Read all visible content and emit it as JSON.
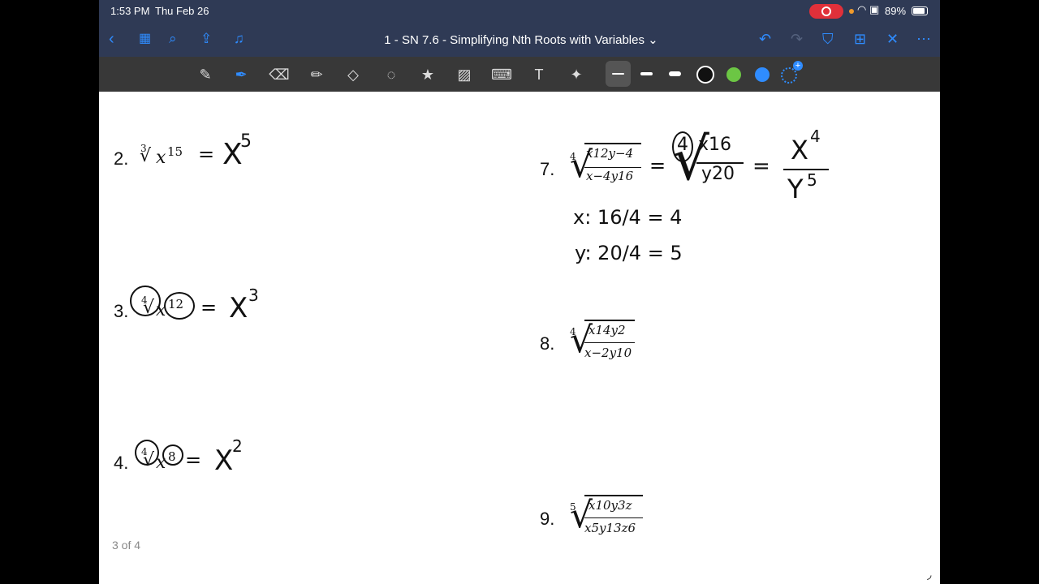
{
  "status": {
    "time": "1:53 PM",
    "date": "Thu Feb 26",
    "battery": "89%"
  },
  "nav": {
    "title": "1 - SN 7.6 - Simplifying Nth Roots with Variables",
    "title_chevron": "⌄"
  },
  "toolbar": {
    "colors": [
      "#111111",
      "#6cc644",
      "#2f8cff"
    ]
  },
  "problems": {
    "p2": {
      "num": "2.",
      "index": "3",
      "radicand": "x",
      "exp": "15",
      "answer": "X",
      "ans_exp": "5"
    },
    "p3": {
      "num": "3.",
      "index": "4",
      "radicand": "x",
      "exp": "12",
      "answer": "X",
      "ans_exp": "3"
    },
    "p4": {
      "num": "4.",
      "index": "4",
      "radicand": "x",
      "exp": "8",
      "answer": "X",
      "ans_exp": "2"
    },
    "p7": {
      "num": "7.",
      "index": "4",
      "num_expr": "x12y−4",
      "den_expr": "x−4y16",
      "step_index": "4",
      "step_num": "x16",
      "step_den": "y20",
      "answer_num": "X",
      "answer_num_exp": "4",
      "answer_den": "Y",
      "answer_den_exp": "5",
      "work_x": "x: 16/4 = 4",
      "work_y": "y: 20/4 = 5"
    },
    "p8": {
      "num": "8.",
      "index": "4",
      "numerator": "x14y2",
      "denominator": "x−2y10"
    },
    "p9": {
      "num": "9.",
      "index": "5",
      "numerator": "x10y3z",
      "denominator": "x5y13z6"
    }
  },
  "page_indicator": "3 of 4"
}
